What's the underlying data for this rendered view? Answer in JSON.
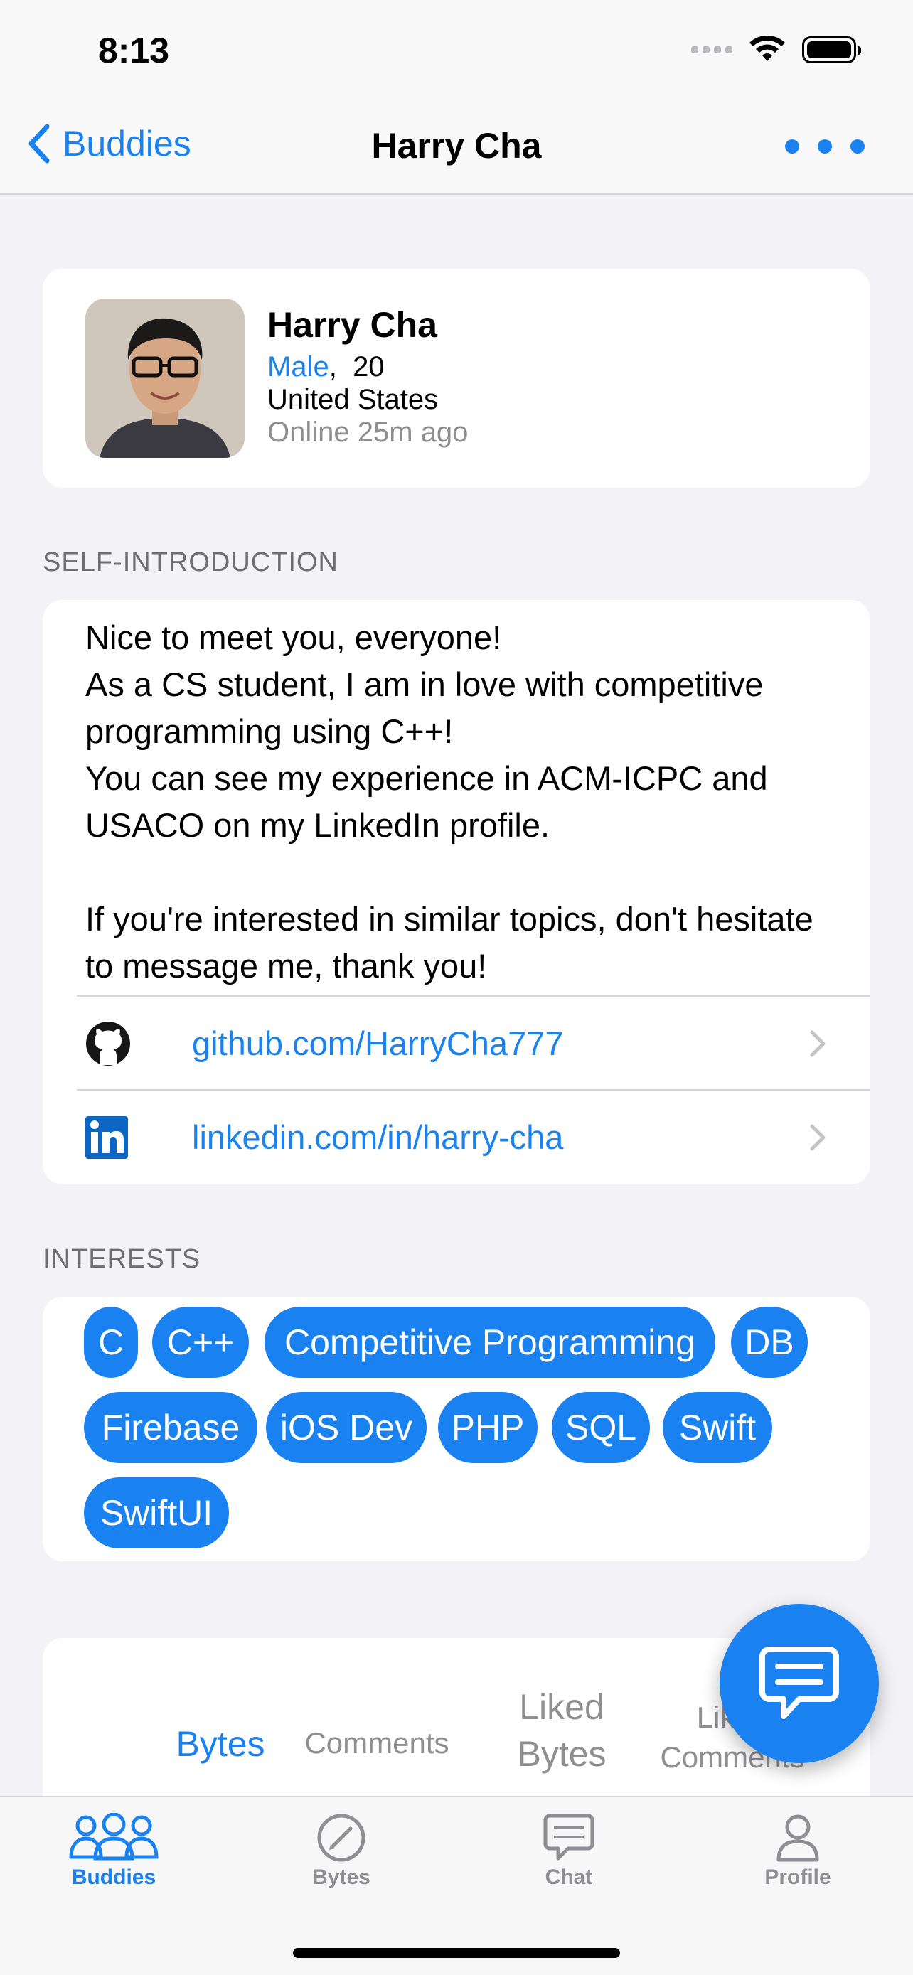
{
  "status_bar": {
    "time": "8:13"
  },
  "nav": {
    "back_label": "Buddies",
    "title": "Harry Cha"
  },
  "profile": {
    "name": "Harry Cha",
    "gender": "Male",
    "age_separator": ",",
    "age": "20",
    "country": "United States",
    "online": "Online 25m ago"
  },
  "sections": {
    "intro": "SELF-INTRODUCTION",
    "interests": "INTERESTS"
  },
  "intro": {
    "text": "Nice to meet you, everyone!\nAs a CS student, I am in love with competitive programming using C++!\nYou can see my experience in ACM-ICPC and USACO on my LinkedIn profile.\n\nIf you're interested in similar topics, don't hesitate to message me, thank you!",
    "links": [
      {
        "icon": "github-icon",
        "text": "github.com/HarryCha777"
      },
      {
        "icon": "linkedin-icon",
        "text": "linkedin.com/in/harry-cha"
      }
    ]
  },
  "interests": [
    "C",
    "C++",
    "Competitive Programming",
    "DB",
    "Firebase",
    "iOS Dev",
    "PHP",
    "SQL",
    "Swift",
    "SwiftUI"
  ],
  "content_tabs": {
    "bytes": "Bytes",
    "comments": "Comments",
    "liked_bytes": "Liked\nBytes",
    "liked_comments": "Liked\nComments"
  },
  "tab_bar": {
    "buddies": "Buddies",
    "bytes": "Bytes",
    "chat": "Chat",
    "profile": "Profile"
  },
  "colors": {
    "accent": "#1a82f0",
    "background": "#f2f2f7",
    "secondary_text": "#8e8e93"
  }
}
